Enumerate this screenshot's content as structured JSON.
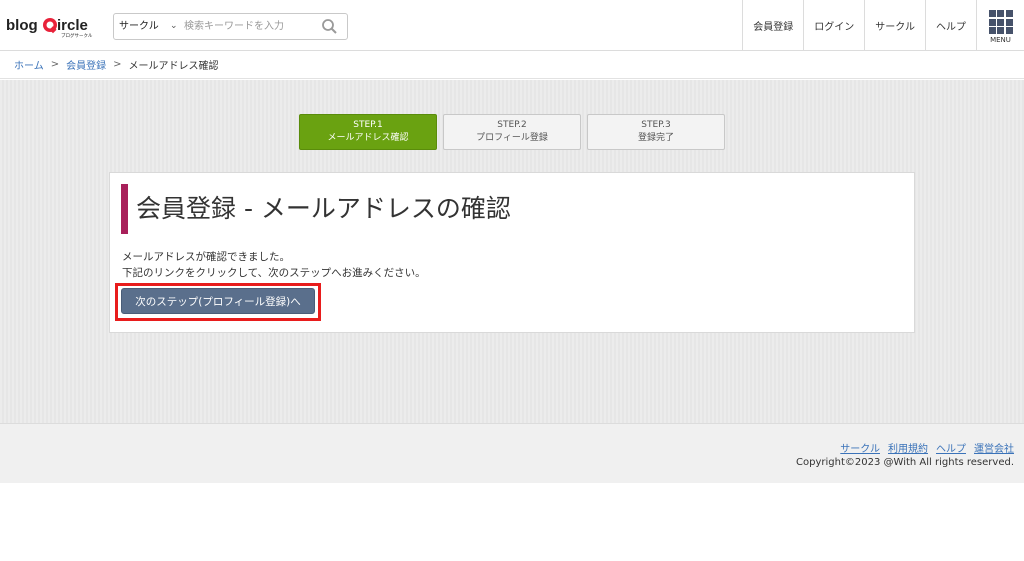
{
  "header": {
    "logo_text": "blogCircle",
    "logo_sub": "ブログサークル",
    "search": {
      "select_value": "サークル",
      "placeholder": "検索キーワードを入力"
    },
    "nav": [
      "会員登録",
      "ログイン",
      "サークル",
      "ヘルプ"
    ],
    "menu_label": "MENU"
  },
  "breadcrumb": {
    "items": [
      "ホーム",
      "会員登録"
    ],
    "separator": ">",
    "current": "メールアドレス確認"
  },
  "steps": [
    {
      "step": "STEP.1",
      "label": "メールアドレス確認",
      "active": true
    },
    {
      "step": "STEP.2",
      "label": "プロフィール登録",
      "active": false
    },
    {
      "step": "STEP.3",
      "label": "登録完了",
      "active": false
    }
  ],
  "panel": {
    "title": "会員登録 - メールアドレスの確認",
    "message_line1": "メールアドレスが確認できました。",
    "message_line2": "下記のリンクをクリックして、次のステップへお進みください。",
    "next_button": "次のステップ(プロフィール登録)へ"
  },
  "footer": {
    "links": [
      "サークル",
      "利用規約",
      "ヘルプ",
      "運営会社"
    ],
    "copyright": "Copyright©2023 @With All rights reserved."
  },
  "colors": {
    "accent_green": "#6aa211",
    "title_bar": "#a8205a",
    "button": "#5a6f8c",
    "highlight": "#e81c1c",
    "link": "#3b73b9"
  }
}
